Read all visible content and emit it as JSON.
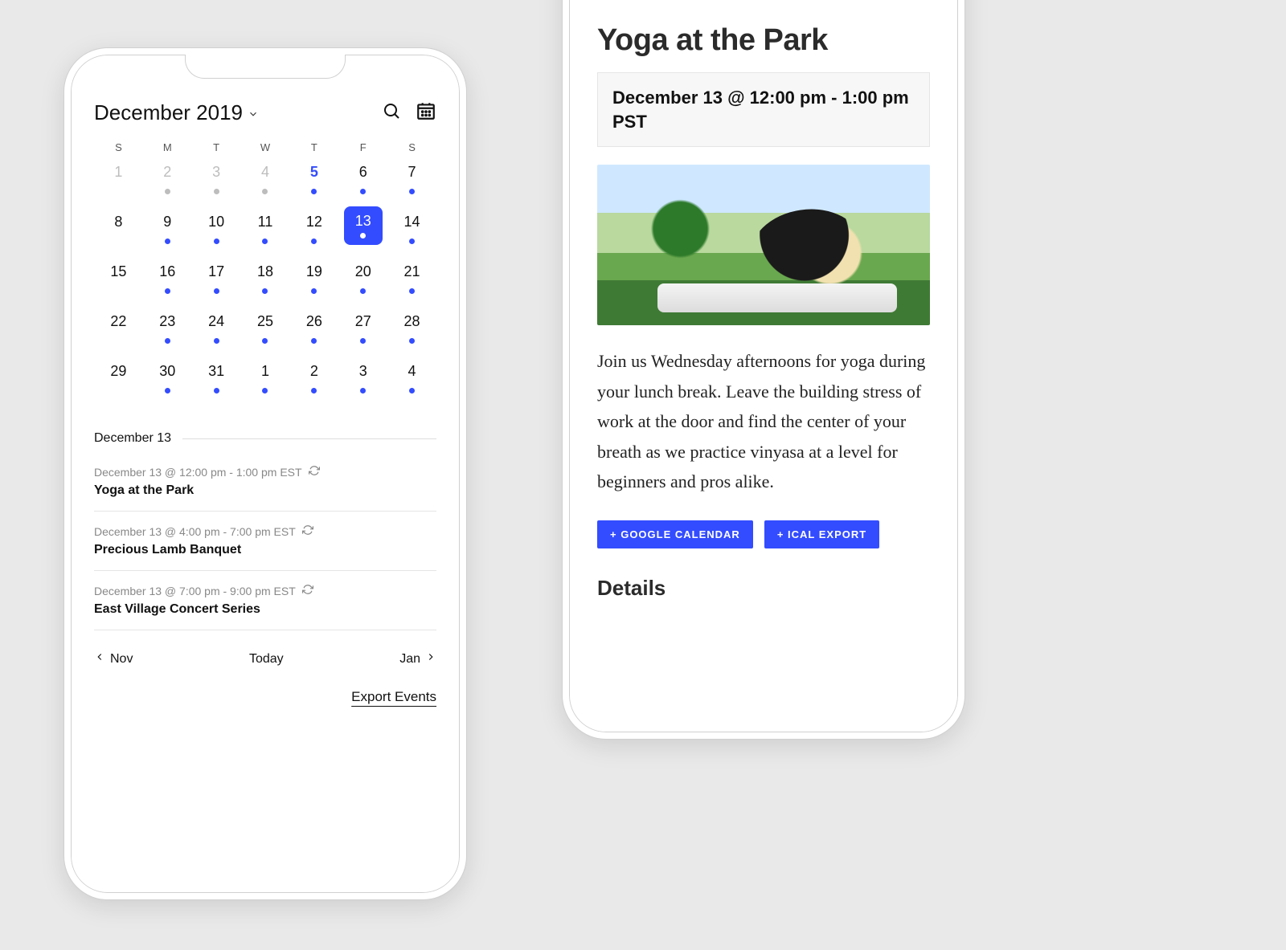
{
  "colors": {
    "accent": "#334cff"
  },
  "calendar": {
    "month_label": "December 2019",
    "dow": [
      "S",
      "M",
      "T",
      "W",
      "T",
      "F",
      "S"
    ],
    "weeks": [
      [
        {
          "n": "1",
          "muted": true,
          "dot": null
        },
        {
          "n": "2",
          "muted": true,
          "dot": "grey"
        },
        {
          "n": "3",
          "muted": true,
          "dot": "grey"
        },
        {
          "n": "4",
          "muted": true,
          "dot": "grey"
        },
        {
          "n": "5",
          "today": true,
          "dot": "blue"
        },
        {
          "n": "6",
          "dot": "blue"
        },
        {
          "n": "7",
          "dot": "blue"
        }
      ],
      [
        {
          "n": "8",
          "dot": null
        },
        {
          "n": "9",
          "dot": "blue"
        },
        {
          "n": "10",
          "dot": "blue"
        },
        {
          "n": "11",
          "dot": "blue"
        },
        {
          "n": "12",
          "dot": "blue"
        },
        {
          "n": "13",
          "selected": true,
          "dot": "white"
        },
        {
          "n": "14",
          "dot": "blue"
        }
      ],
      [
        {
          "n": "15",
          "dot": null
        },
        {
          "n": "16",
          "dot": "blue"
        },
        {
          "n": "17",
          "dot": "blue"
        },
        {
          "n": "18",
          "dot": "blue"
        },
        {
          "n": "19",
          "dot": "blue"
        },
        {
          "n": "20",
          "dot": "blue"
        },
        {
          "n": "21",
          "dot": "blue"
        }
      ],
      [
        {
          "n": "22",
          "dot": null
        },
        {
          "n": "23",
          "dot": "blue"
        },
        {
          "n": "24",
          "dot": "blue"
        },
        {
          "n": "25",
          "dot": "blue"
        },
        {
          "n": "26",
          "dot": "blue"
        },
        {
          "n": "27",
          "dot": "blue"
        },
        {
          "n": "28",
          "dot": "blue"
        }
      ],
      [
        {
          "n": "29",
          "dot": null
        },
        {
          "n": "30",
          "dot": "blue"
        },
        {
          "n": "31",
          "dot": "blue"
        },
        {
          "n": "1",
          "dot": "blue"
        },
        {
          "n": "2",
          "dot": "blue"
        },
        {
          "n": "3",
          "dot": "blue"
        },
        {
          "n": "4",
          "dot": "blue"
        }
      ]
    ],
    "selected_date_label": "December 13",
    "events": [
      {
        "time": "December 13 @ 12:00 pm - 1:00 pm EST",
        "recurring": true,
        "title": "Yoga at the Park"
      },
      {
        "time": "December 13 @ 4:00 pm - 7:00 pm EST",
        "recurring": true,
        "title": "Precious Lamb Banquet"
      },
      {
        "time": "December 13 @ 7:00 pm - 9:00 pm EST",
        "recurring": true,
        "title": "East Village Concert Series"
      }
    ],
    "nav": {
      "prev": "Nov",
      "today": "Today",
      "next": "Jan"
    },
    "export_label": "Export Events"
  },
  "event_detail": {
    "title": "Yoga at the Park",
    "datetime": "December 13 @ 12:00 pm - 1:00 pm PST",
    "description": "Join us Wednesday afternoons for yoga during your lunch break. Leave the building stress of work at the door and find the center of your breath as we practice vinyasa at a level for beginners and pros alike.",
    "buttons": {
      "gcal": "+ GOOGLE CALENDAR",
      "ical": "+ ICAL EXPORT"
    },
    "details_heading": "Details"
  }
}
